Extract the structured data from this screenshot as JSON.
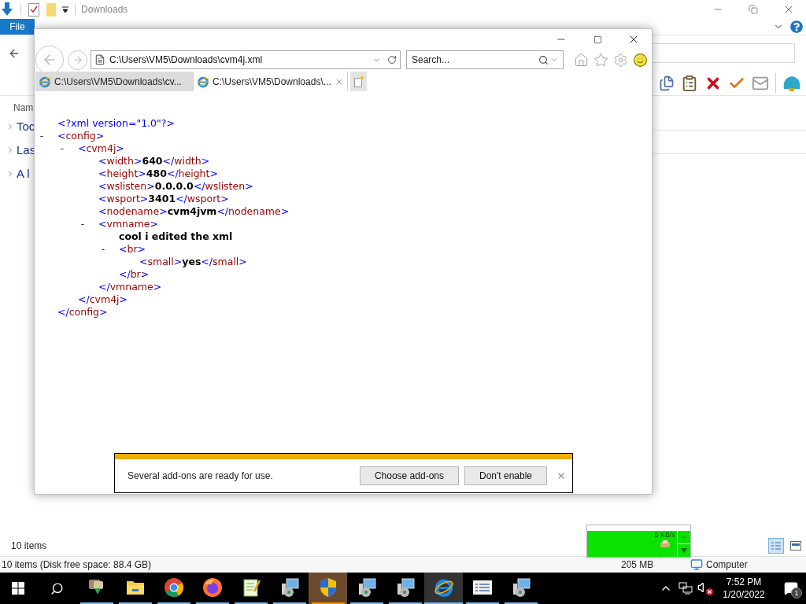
{
  "explorer": {
    "title": "Downloads",
    "ribbon_tabs": [
      {
        "label": "File",
        "selected": true
      }
    ],
    "column_header": "Nam",
    "nav_items": [
      "Toc",
      "Las",
      "A l"
    ],
    "item_count": "10 items",
    "status": {
      "summary": "10 items (Disk free space: 88.4 GB)",
      "size": "205 MB",
      "location": "Computer"
    }
  },
  "browser": {
    "address": "C:\\Users\\VM5\\Downloads\\cvm4j.xml",
    "search_placeholder": "Search...",
    "tabs": [
      {
        "title": "C:\\Users\\VM5\\Downloads\\cv...",
        "selected": false
      },
      {
        "title": "C:\\Users\\VM5\\Downloads\\...",
        "selected": true
      }
    ],
    "document": [
      {
        "kind": "pi",
        "text": "<?xml version=\"1.0\"?>"
      },
      {
        "kind": "element",
        "toggle": "-",
        "open_tag": "<config>",
        "close_tag": "</config>",
        "children": [
          {
            "kind": "element",
            "toggle": "-",
            "open_tag": "<cvm4j>",
            "close_tag": "</cvm4j>",
            "children": [
              {
                "kind": "leaf",
                "open_tag": "<width>",
                "value": "640",
                "close_tag": "</width>"
              },
              {
                "kind": "leaf",
                "open_tag": "<height>",
                "value": "480",
                "close_tag": "</height>"
              },
              {
                "kind": "leaf",
                "open_tag": "<wslisten>",
                "value": "0.0.0.0",
                "close_tag": "</wslisten>"
              },
              {
                "kind": "leaf",
                "open_tag": "<wsport>",
                "value": "3401",
                "close_tag": "</wsport>"
              },
              {
                "kind": "leaf",
                "open_tag": "<nodename>",
                "value": "cvm4jvm",
                "close_tag": "</nodename>"
              },
              {
                "kind": "element",
                "toggle": "-",
                "open_tag": "<vmname>",
                "close_tag": "</vmname>",
                "children": [
                  {
                    "kind": "text",
                    "value": "cool i edited the xml"
                  },
                  {
                    "kind": "element",
                    "toggle": "-",
                    "open_tag": "<br>",
                    "close_tag": "</br>",
                    "children": [
                      {
                        "kind": "leaf",
                        "open_tag": "<small>",
                        "value": "yes",
                        "close_tag": "</small>"
                      }
                    ]
                  }
                ]
              }
            ]
          }
        ]
      }
    ],
    "notification": {
      "text": "Several add-ons are ready for use.",
      "buttons": [
        "Choose add-ons",
        "Don't enable"
      ]
    }
  },
  "network_meter": {
    "speed": "5 KB/s"
  },
  "taskbar": {
    "apps": [
      {
        "kind": "installer",
        "flashing": false,
        "focused": false
      },
      {
        "kind": "folder",
        "flashing": false,
        "focused": false
      },
      {
        "kind": "chrome",
        "flashing": false,
        "focused": false
      },
      {
        "kind": "firefox",
        "flashing": false,
        "focused": false
      },
      {
        "kind": "notepad",
        "flashing": false,
        "focused": false
      },
      {
        "kind": "setup",
        "flashing": false,
        "focused": false
      },
      {
        "kind": "shield",
        "flashing": true,
        "focused": false
      },
      {
        "kind": "setup",
        "flashing": false,
        "focused": false
      },
      {
        "kind": "setup",
        "flashing": false,
        "focused": false
      },
      {
        "kind": "ie",
        "flashing": false,
        "focused": true
      },
      {
        "kind": "list",
        "flashing": false,
        "focused": false
      },
      {
        "kind": "setup",
        "flashing": false,
        "focused": false
      }
    ],
    "clock": {
      "time": "7:52 PM",
      "date": "1/20/2022"
    },
    "notification_count": "1"
  }
}
